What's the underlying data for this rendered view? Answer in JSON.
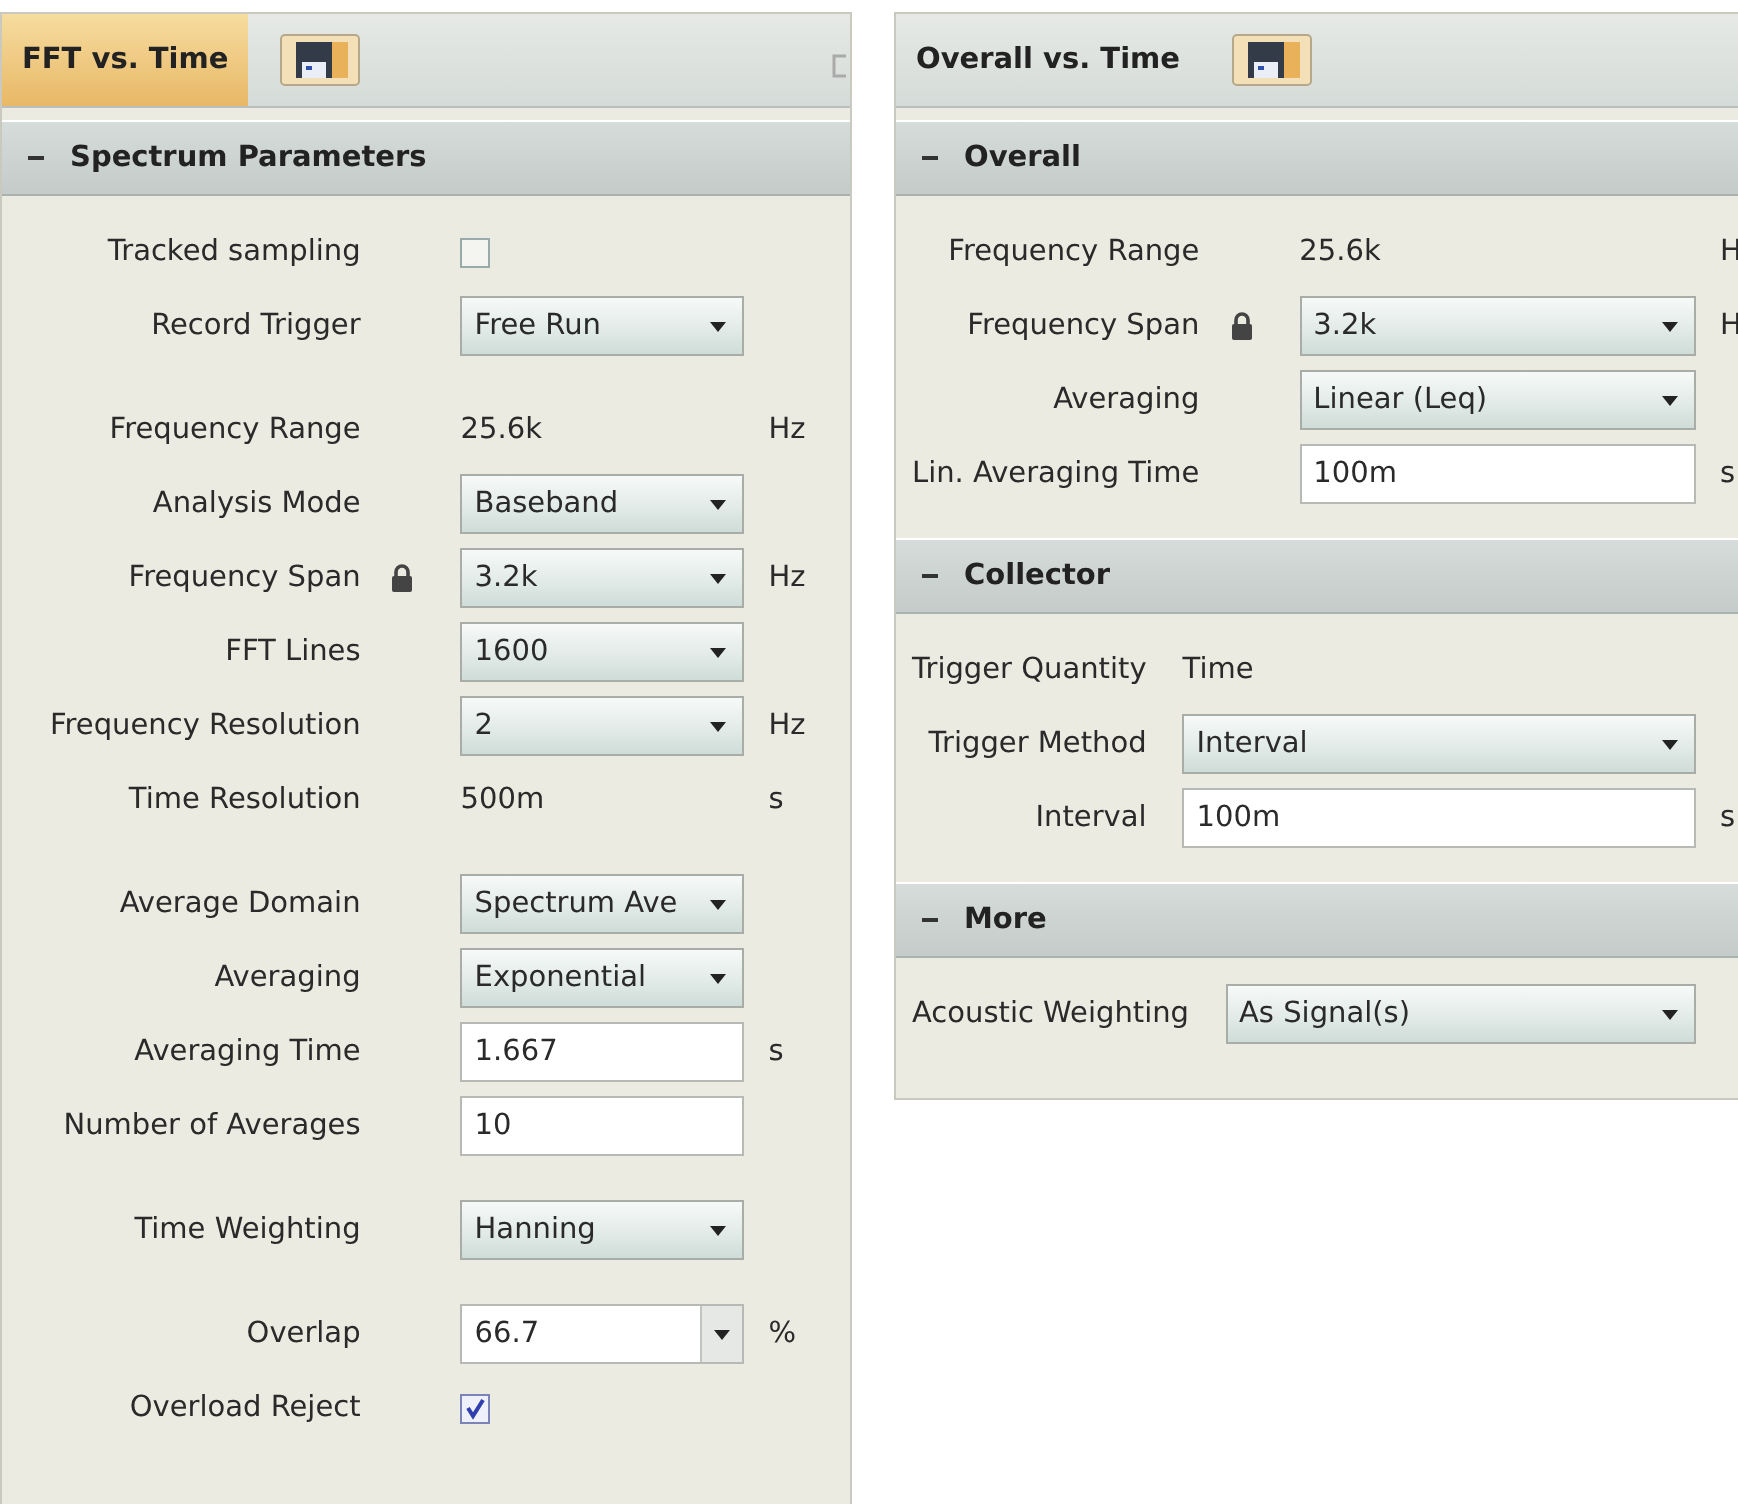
{
  "panels": [
    {
      "tab": {
        "title": "FFT vs. Time",
        "selected": true
      },
      "sections": [
        {
          "title": "Spectrum Parameters",
          "expanded": true,
          "groups": [
            [
              {
                "kind": "checkbox",
                "label": "Tracked sampling",
                "checked": false,
                "locked": false
              },
              {
                "kind": "dropdown",
                "label": "Record Trigger",
                "value": "Free Run",
                "locked": false
              }
            ],
            [
              {
                "kind": "readout",
                "label": "Frequency Range",
                "value": "25.6k",
                "unit": "Hz",
                "locked": false
              },
              {
                "kind": "dropdown",
                "label": "Analysis Mode",
                "value": "Baseband",
                "locked": false
              },
              {
                "kind": "dropdown",
                "label": "Frequency Span",
                "value": "3.2k",
                "unit": "Hz",
                "locked": true
              },
              {
                "kind": "dropdown",
                "label": "FFT Lines",
                "value": "1600",
                "locked": false
              },
              {
                "kind": "dropdown",
                "label": "Frequency Resolution",
                "value": "2",
                "unit": "Hz",
                "locked": false
              },
              {
                "kind": "readout",
                "label": "Time Resolution",
                "value": "500m",
                "unit": "s",
                "locked": false
              }
            ],
            [
              {
                "kind": "dropdown",
                "label": "Average Domain",
                "value": "Spectrum Ave",
                "locked": false
              },
              {
                "kind": "dropdown",
                "label": "Averaging",
                "value": "Exponential",
                "locked": false
              },
              {
                "kind": "input",
                "label": "Averaging Time",
                "value": "1.667",
                "unit": "s",
                "locked": false
              },
              {
                "kind": "input",
                "label": "Number of Averages",
                "value": "10",
                "locked": false
              }
            ],
            [
              {
                "kind": "dropdown",
                "label": "Time Weighting",
                "value": "Hanning",
                "locked": false
              }
            ],
            [
              {
                "kind": "combo",
                "label": "Overlap",
                "value": "66.7",
                "unit": "%",
                "locked": false
              },
              {
                "kind": "checkbox",
                "label": "Overload Reject",
                "checked": true,
                "locked": false
              }
            ]
          ]
        }
      ]
    },
    {
      "tab": {
        "title": "Overall vs. Time",
        "selected": false
      },
      "sections": [
        {
          "title": "Overall",
          "expanded": true,
          "groups": [
            [
              {
                "kind": "readout",
                "label": "Frequency Range",
                "value": "25.6k",
                "unit": "H",
                "locked": false
              },
              {
                "kind": "dropdown",
                "label": "Frequency Span",
                "value": "3.2k",
                "unit": "H",
                "locked": true
              },
              {
                "kind": "dropdown",
                "label": "Averaging",
                "value": "Linear (Leq)",
                "locked": false
              },
              {
                "kind": "input",
                "label": "Lin. Averaging Time",
                "value": "100m",
                "unit": "s",
                "locked": false
              }
            ]
          ]
        },
        {
          "title": "Collector",
          "expanded": true,
          "groups": [
            [
              {
                "kind": "readout",
                "label": "Trigger Quantity",
                "value": "Time"
              },
              {
                "kind": "dropdown",
                "label": "Trigger Method",
                "value": "Interval"
              },
              {
                "kind": "input",
                "label": "Interval",
                "value": "100m",
                "unit": "s"
              }
            ]
          ]
        },
        {
          "title": "More",
          "expanded": true,
          "groups": [
            [
              {
                "kind": "dropdown",
                "label": "Acoustic Weighting",
                "value": "As Signal(s)"
              }
            ]
          ]
        }
      ]
    }
  ]
}
